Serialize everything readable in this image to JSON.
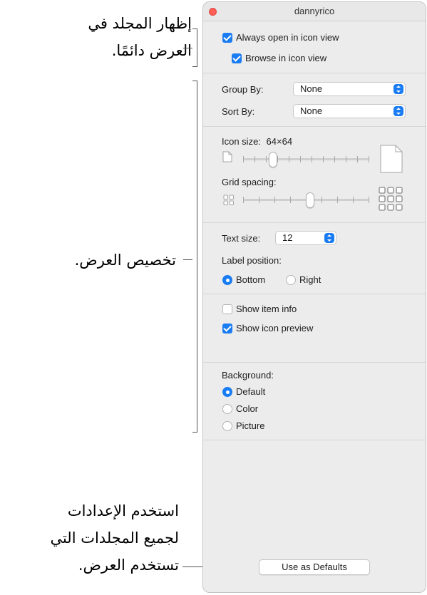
{
  "callouts": {
    "top": [
      "إظهار المجلد في",
      "العرض دائمًا."
    ],
    "middle": [
      "تخصيص العرض."
    ],
    "bottom": [
      "استخدم الإعدادات",
      "لجميع المجلدات التي",
      "تستخدم العرض."
    ]
  },
  "window": {
    "title": "dannyrico"
  },
  "open": {
    "always_open": {
      "label": "Always open in icon view",
      "checked": true
    },
    "browse": {
      "label": "Browse in icon view",
      "checked": true
    }
  },
  "grouping": {
    "group_by": {
      "label": "Group By:",
      "value": "None"
    },
    "sort_by": {
      "label": "Sort By:",
      "value": "None"
    }
  },
  "icon_size": {
    "label": "Icon size:",
    "value": "64×64",
    "level": 0.15
  },
  "grid_spacing": {
    "label": "Grid spacing:",
    "level": 0.5
  },
  "text": {
    "text_size": {
      "label": "Text size:",
      "value": "12"
    },
    "label_position": {
      "label": "Label position:",
      "options": [
        "Bottom",
        "Right"
      ],
      "selected": "Bottom"
    }
  },
  "info": {
    "show_item_info": {
      "label": "Show item info",
      "checked": false
    },
    "show_icon_preview": {
      "label": "Show icon preview",
      "checked": true
    }
  },
  "background": {
    "label": "Background:",
    "options": [
      "Default",
      "Color",
      "Picture"
    ],
    "selected": "Default"
  },
  "defaults_button": "Use as Defaults",
  "colors": {
    "accent": "#1a7cf2",
    "close": "#fe5f57"
  }
}
